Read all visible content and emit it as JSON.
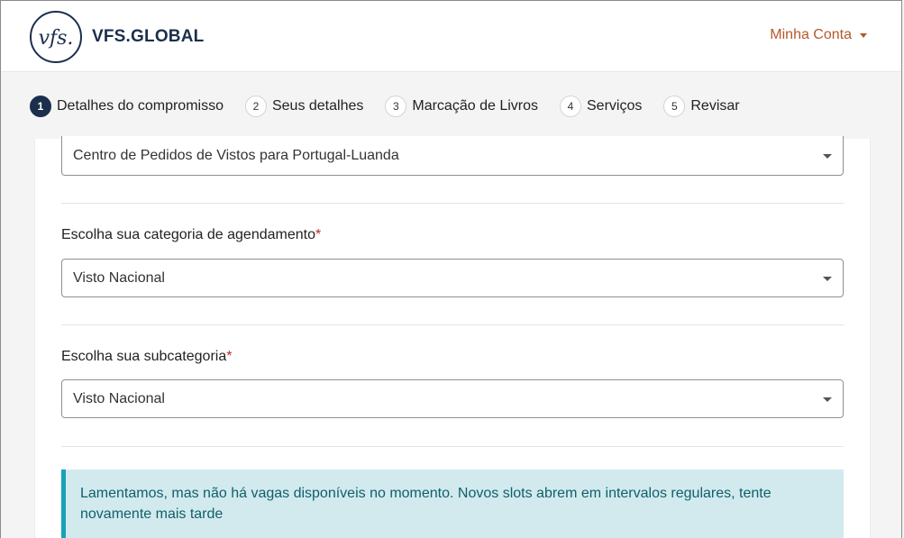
{
  "header": {
    "logo_text": "VFS.GLOBAL",
    "logo_mark": "vfs.",
    "account_label": "Minha Conta"
  },
  "stepper": {
    "steps": [
      {
        "number": "1",
        "label": "Detalhes do compromisso",
        "active": true
      },
      {
        "number": "2",
        "label": "Seus detalhes",
        "active": false
      },
      {
        "number": "3",
        "label": "Marcação de Livros",
        "active": false
      },
      {
        "number": "4",
        "label": "Serviços",
        "active": false
      },
      {
        "number": "5",
        "label": "Revisar",
        "active": false
      }
    ]
  },
  "form": {
    "centre_value": "Centro de Pedidos de Vistos para Portugal-Luanda",
    "category_label": "Escolha sua categoria de agendamento",
    "category_value": "Visto Nacional",
    "subcategory_label": "Escolha sua subcategoria",
    "subcategory_value": "Visto Nacional",
    "required_mark": "*"
  },
  "alert": {
    "message": "Lamentamos, mas não há vagas disponíveis no momento. Novos slots abrem em intervalos regulares, tente novamente mais tarde"
  },
  "colors": {
    "brand_navy": "#1b2f4c",
    "account_orange": "#b4592a",
    "alert_bg": "#d2eaee",
    "alert_border": "#17a2b8",
    "required_red": "#c0282d"
  }
}
